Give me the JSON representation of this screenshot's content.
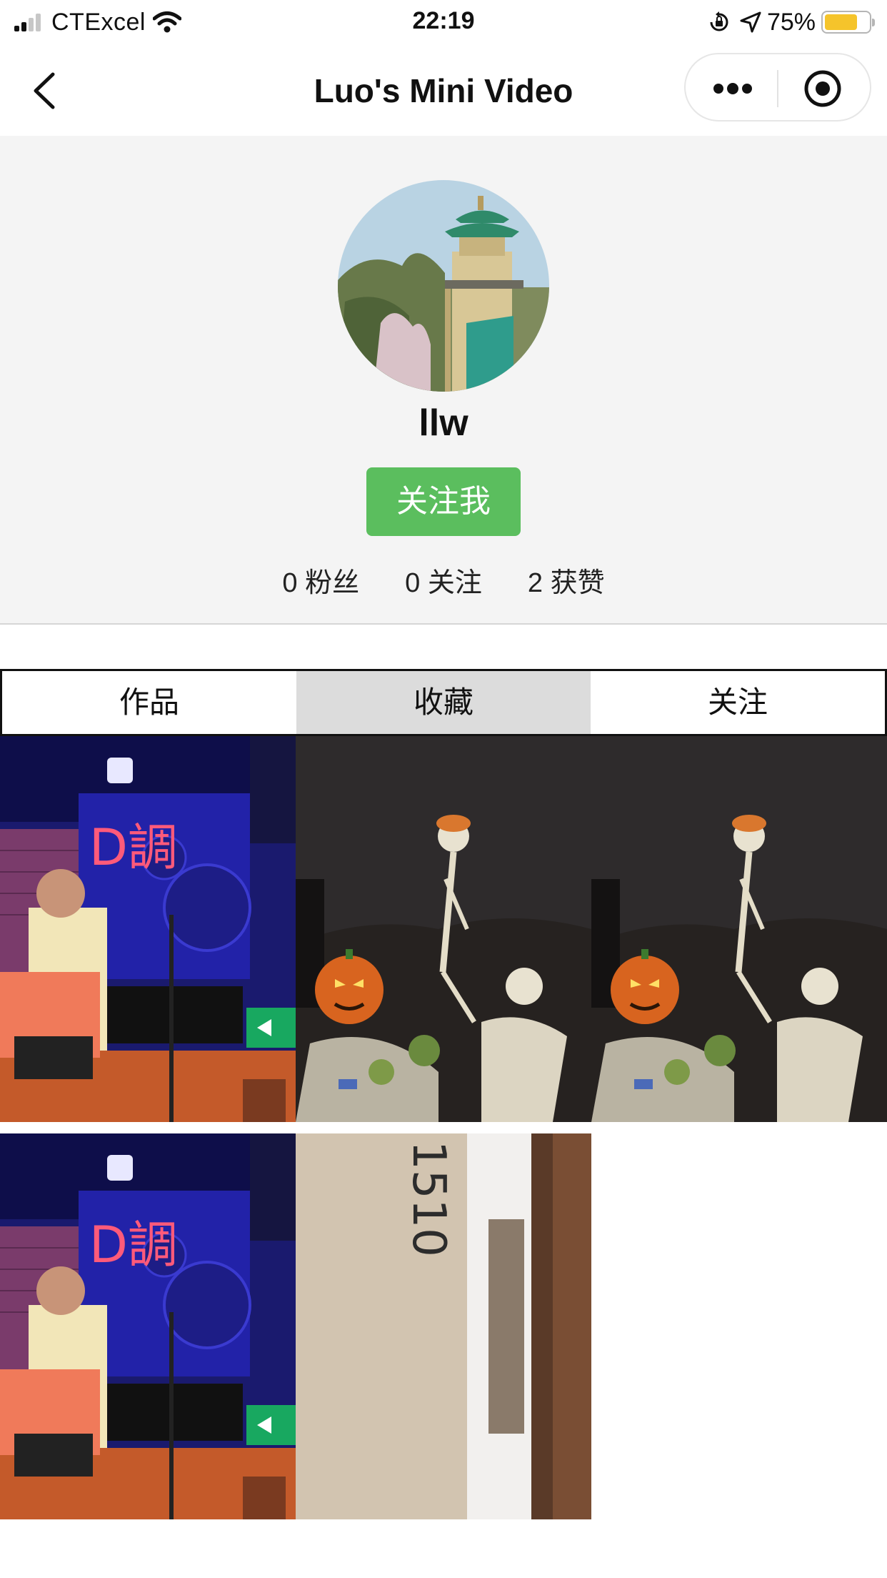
{
  "status_bar": {
    "carrier": "CTExcel",
    "time": "22:19",
    "battery_percent": "75%",
    "battery_level": 0.75,
    "icons": [
      "signal-icon",
      "wifi-icon",
      "orientation-lock-icon",
      "location-icon",
      "battery-icon"
    ]
  },
  "nav": {
    "title": "Luo's Mini Video",
    "icons": [
      "back-chevron-icon",
      "more-dots-icon",
      "close-target-icon"
    ]
  },
  "profile": {
    "username": "llw",
    "follow_label": "关注我",
    "stats": [
      {
        "count": "0",
        "label": "粉丝"
      },
      {
        "count": "0",
        "label": "关注"
      },
      {
        "count": "2",
        "label": "获赞"
      }
    ]
  },
  "tabs": [
    {
      "label": "作品",
      "active": false
    },
    {
      "label": "收藏",
      "active": true
    },
    {
      "label": "关注",
      "active": false
    }
  ],
  "videos": [
    {
      "subject": "concert-stage",
      "signage": "D調"
    },
    {
      "subject": "halloween-skeletons"
    },
    {
      "subject": "halloween-skeletons"
    },
    {
      "subject": "concert-stage",
      "signage": "D調"
    },
    {
      "subject": "room-door",
      "signage": "1510"
    }
  ],
  "colors": {
    "accent_green": "#5bbe5e",
    "header_bg": "#f4f4f4",
    "active_tab_bg": "#dcdcdc",
    "battery_fill": "#f5c42b"
  }
}
